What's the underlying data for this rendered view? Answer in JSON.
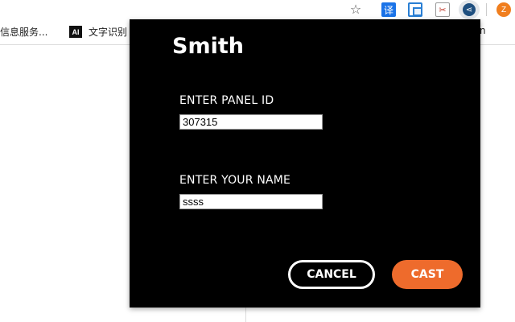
{
  "toolbar": {
    "icons": [
      "star-icon",
      "translate-icon",
      "dual-window-icon",
      "scissors-icon",
      "share-icon",
      "avatar"
    ],
    "translate_glyph": "译",
    "scissors_glyph": "✂",
    "share_glyph": "⋖",
    "avatar_letter": "Z"
  },
  "bookmarks": {
    "items": [
      {
        "label": "信息服务..."
      },
      {
        "icon_text": "AI",
        "label": "文字识别"
      },
      {
        "label": "n"
      }
    ]
  },
  "popup": {
    "title": "Smith",
    "panel_id_label": "ENTER PANEL ID",
    "panel_id_value": "307315",
    "name_label": "ENTER YOUR NAME",
    "name_value": "ssss",
    "cancel_label": "CANCEL",
    "cast_label": "CAST"
  },
  "colors": {
    "popup_background": "#000000",
    "cast_button": "#ee6b2c",
    "avatar": "#f07e1e",
    "translate_icon": "#1a73e8"
  }
}
